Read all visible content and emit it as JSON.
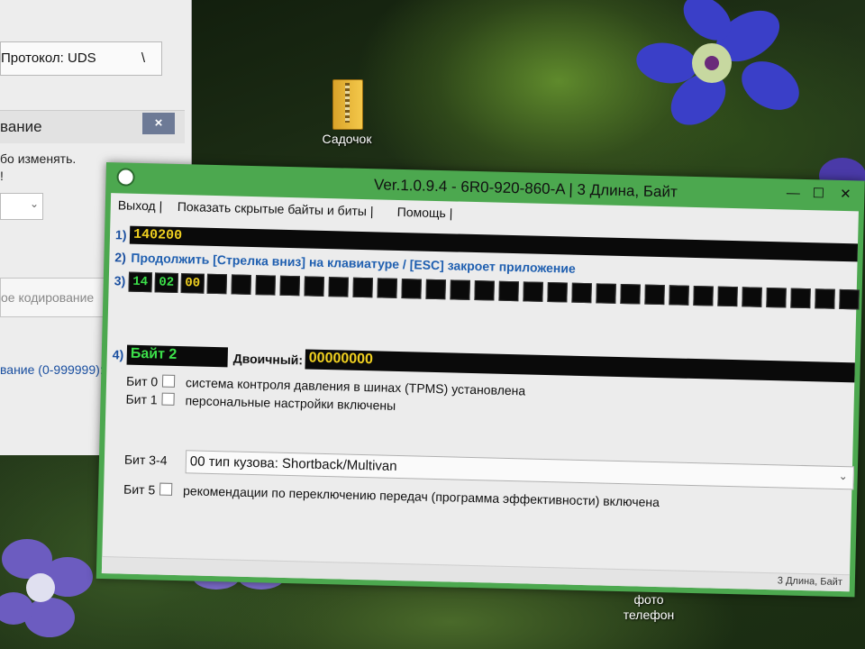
{
  "background_window": {
    "protocol_field": "Протокол: UDS",
    "protocol_suffix": "\\",
    "section_title": "вание",
    "close_label": "×",
    "line1": "бо изменять.",
    "line2": "!",
    "textarea_placeholder": "ое кодирование",
    "range_label": "вание (0-999999):"
  },
  "desktop": {
    "folder_label": "Садочок",
    "photo_label": "фото\nтелефон"
  },
  "window": {
    "title": "Ver.1.0.9.4 -   6R0-920-860-A | 3 Длина, Байт",
    "minimize": "—",
    "maximize": "☐",
    "close": "✕",
    "accent_color": "#4ca84f"
  },
  "menu": [
    {
      "label": "Выход |"
    },
    {
      "label": "Показать скрытые байты и биты |"
    },
    {
      "label": "Помощь |"
    }
  ],
  "rows": {
    "r1_num": "1)",
    "r1_value": "140200",
    "r2_num": "2)",
    "r2_text": "Продолжить [Стрелка вниз] на клавиатуре / [ESC] закроет приложение",
    "r3_num": "3)",
    "r4_num": "4)"
  },
  "bytes": [
    "14",
    "02",
    "00"
  ],
  "selected_byte_index": 2,
  "empty_byte_cells": 27,
  "byte_editor": {
    "selected_label": "Байт 2",
    "binary_label": "Двоичный:",
    "binary_value": "00000000"
  },
  "bits": [
    {
      "label": "Бит 0",
      "checked": false,
      "description": "система контроля давления в шинах (TPMS) установлена"
    },
    {
      "label": "Бит 1",
      "checked": false,
      "description": "персональные настройки включены"
    }
  ],
  "bit34": {
    "label": "Бит 3-4",
    "value": "00 тип кузова:  Shortback/Multivan"
  },
  "bit5": {
    "label": "Бит 5",
    "checked": false,
    "description": "рекомендации по переключению передач (программа эффективности) включена"
  },
  "status": "3 Длина, Байт"
}
